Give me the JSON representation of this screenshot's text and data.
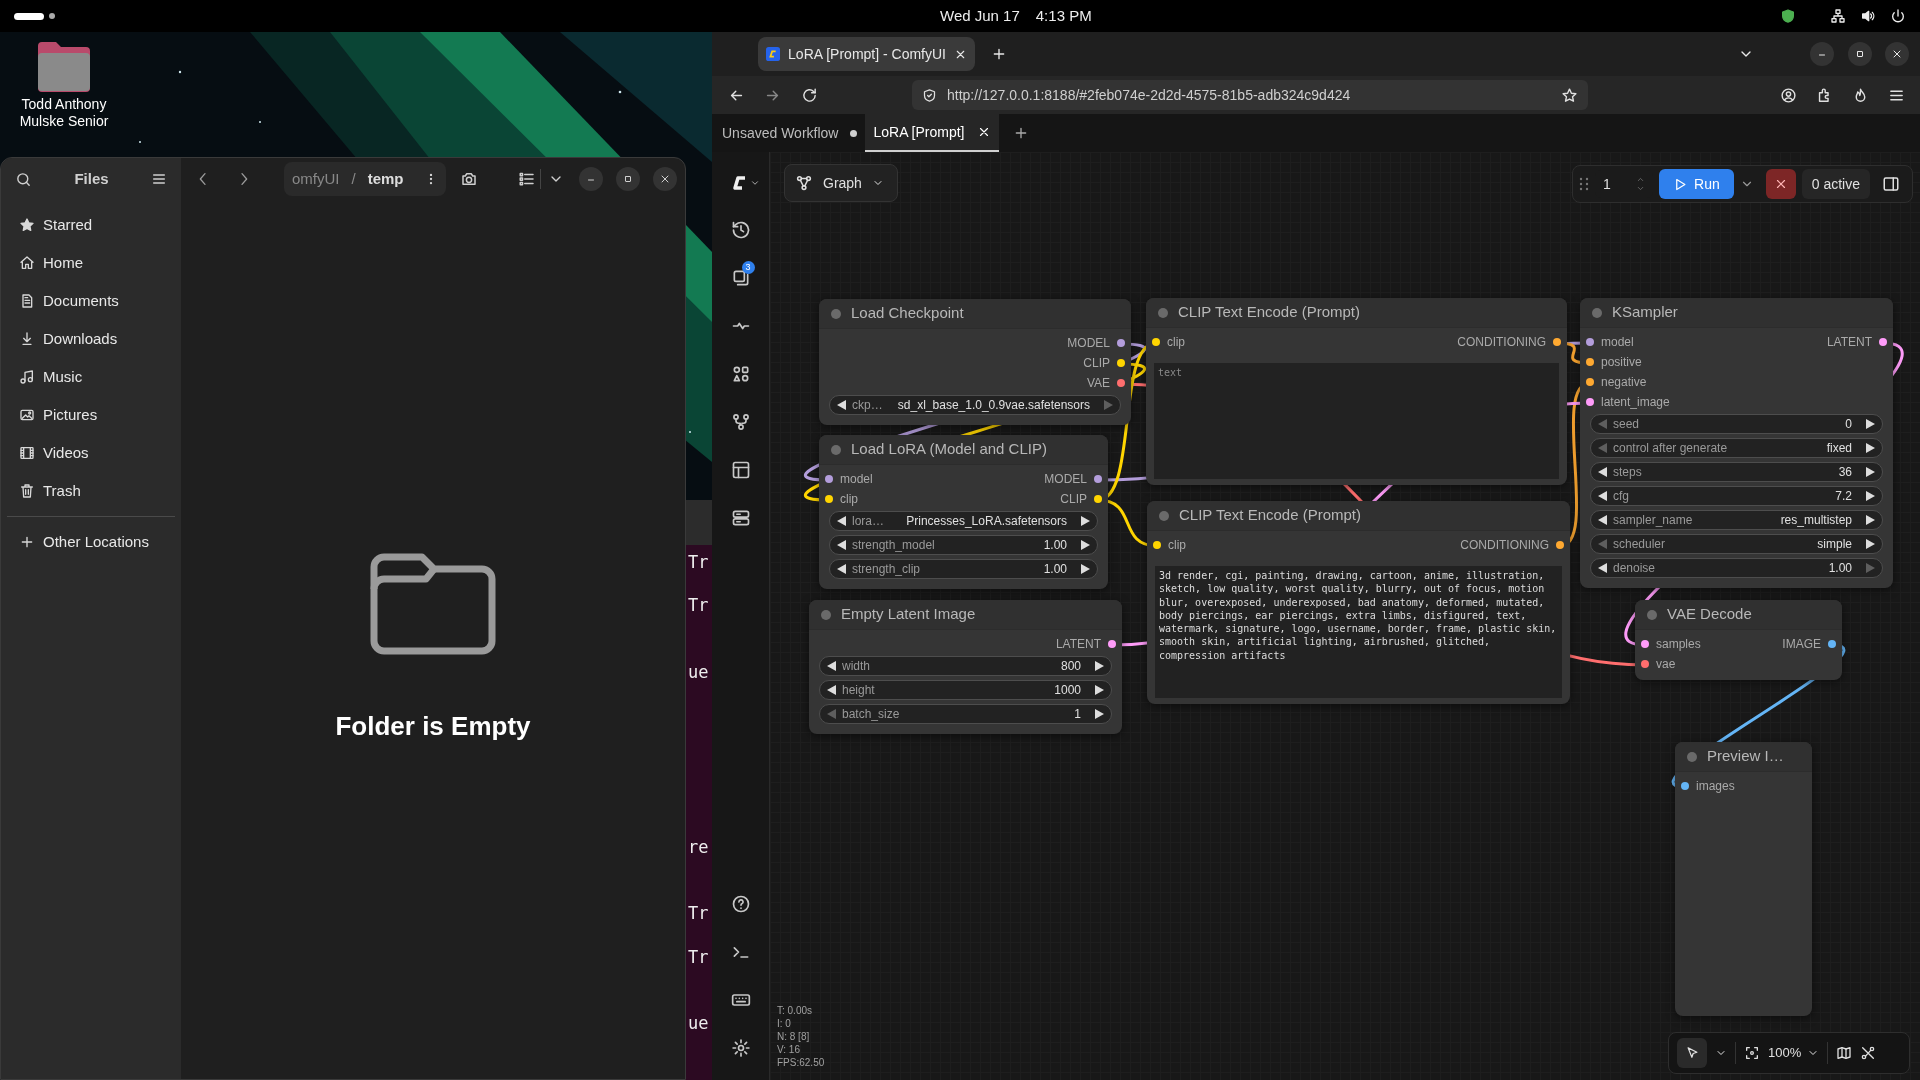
{
  "top_bar": {
    "date": "Wed Jun 17",
    "time": "4:13 PM"
  },
  "desktop": {
    "icons": [
      {
        "label": "Todd Anthony Mulske Senior"
      }
    ]
  },
  "files_window": {
    "title": "Files",
    "path": [
      "omfyUI",
      "temp"
    ],
    "path_separator": "/",
    "places": [
      {
        "label": "Starred"
      },
      {
        "label": "Home"
      },
      {
        "label": "Documents"
      },
      {
        "label": "Downloads"
      },
      {
        "label": "Music"
      },
      {
        "label": "Pictures"
      },
      {
        "label": "Videos"
      },
      {
        "label": "Trash"
      }
    ],
    "other_locations": "Other Locations",
    "empty_message": "Folder is Empty"
  },
  "terminal": {
    "fragments": [
      "Tr",
      "Tr",
      "ue",
      "re",
      "Tr",
      "Tr",
      "ue"
    ]
  },
  "browser": {
    "tabs": [
      {
        "title": "LoRA [Prompt] - ComfyUI",
        "selected": true
      }
    ],
    "url": "http://127.0.0.1:8188/#2feb074e-2d2d-4575-81b5-adb324c9d424"
  },
  "comfyui": {
    "workflow_tabs": [
      {
        "label": "Unsaved Workflow",
        "selected": false,
        "unsaved": true
      },
      {
        "label": "LoRA [Prompt]",
        "selected": true,
        "unsaved": false
      }
    ],
    "view_mode": "Graph",
    "queue_badge": "3",
    "batch_count": "1",
    "run_label": "Run",
    "active_label": "0 active",
    "nodes": [
      {
        "title": "Load Checkpoint",
        "outputs": [
          {
            "name": "MODEL",
            "color": "#b39ddb"
          },
          {
            "name": "CLIP",
            "color": "#ffd500"
          },
          {
            "name": "VAE",
            "color": "#ff6e6e"
          }
        ],
        "widgets": [
          {
            "label": "ckp…",
            "value": "sd_xl_base_1.0_0.9vae.safetensors",
            "prev_enabled": true,
            "next_enabled": false
          }
        ]
      },
      {
        "title": "Load LoRA (Model and CLIP)",
        "inputs": [
          {
            "name": "model",
            "color": "#b39ddb"
          },
          {
            "name": "clip",
            "color": "#ffd500"
          }
        ],
        "outputs": [
          {
            "name": "MODEL",
            "color": "#b39ddb"
          },
          {
            "name": "CLIP",
            "color": "#ffd500"
          }
        ],
        "widgets": [
          {
            "label": "lora…",
            "value": "Princesses_LoRA.safetensors",
            "prev_enabled": true,
            "next_enabled": true
          },
          {
            "label": "strength_model",
            "value": "1.00",
            "prev_enabled": true,
            "next_enabled": true
          },
          {
            "label": "strength_clip",
            "value": "1.00",
            "prev_enabled": true,
            "next_enabled": true
          }
        ]
      },
      {
        "title": "Empty Latent Image",
        "outputs": [
          {
            "name": "LATENT",
            "color": "#ff9cf9"
          }
        ],
        "widgets": [
          {
            "label": "width",
            "value": "800",
            "prev_enabled": true,
            "next_enabled": true
          },
          {
            "label": "height",
            "value": "1000",
            "prev_enabled": true,
            "next_enabled": true
          },
          {
            "label": "batch_size",
            "value": "1",
            "prev_enabled": false,
            "next_enabled": true
          }
        ]
      },
      {
        "title": "CLIP Text Encode (Prompt)",
        "inputs": [
          {
            "name": "clip",
            "color": "#ffd500"
          }
        ],
        "outputs": [
          {
            "name": "CONDITIONING",
            "color": "#ffa931"
          }
        ],
        "text_area": {
          "placeholder": "text"
        }
      },
      {
        "title": "CLIP Text Encode (Prompt)",
        "inputs": [
          {
            "name": "clip",
            "color": "#ffd500"
          }
        ],
        "outputs": [
          {
            "name": "CONDITIONING",
            "color": "#ffa931"
          }
        ],
        "text_area": {
          "value": "3d render, cgi, painting, drawing, cartoon, anime, illustration, sketch, low quality, worst quality, blurry, out of focus, motion blur, overexposed, underexposed, bad anatomy, deformed, mutated, body piercings, ear piercings, extra limbs, disfigured, text, watermark, signature, logo, username, border, frame, plastic skin, smooth skin, artificial lighting, airbrushed, glitched, compression artifacts"
        }
      },
      {
        "title": "KSampler",
        "inputs": [
          {
            "name": "model",
            "color": "#b39ddb"
          },
          {
            "name": "positive",
            "color": "#ffa931"
          },
          {
            "name": "negative",
            "color": "#ffa931"
          },
          {
            "name": "latent_image",
            "color": "#ff9cf9"
          }
        ],
        "outputs": [
          {
            "name": "LATENT",
            "color": "#ff9cf9"
          }
        ],
        "widgets": [
          {
            "label": "seed",
            "value": "0",
            "prev_enabled": false,
            "next_enabled": true
          },
          {
            "label": "control after generate",
            "value": "fixed",
            "prev_enabled": false,
            "next_enabled": true
          },
          {
            "label": "steps",
            "value": "36",
            "prev_enabled": true,
            "next_enabled": true
          },
          {
            "label": "cfg",
            "value": "7.2",
            "prev_enabled": true,
            "next_enabled": true
          },
          {
            "label": "sampler_name",
            "value": "res_multistep",
            "prev_enabled": true,
            "next_enabled": true
          },
          {
            "label": "scheduler",
            "value": "simple",
            "prev_enabled": false,
            "next_enabled": true
          },
          {
            "label": "denoise",
            "value": "1.00",
            "prev_enabled": true,
            "next_enabled": false
          }
        ]
      },
      {
        "title": "VAE Decode",
        "inputs": [
          {
            "name": "samples",
            "color": "#ff9cf9"
          },
          {
            "name": "vae",
            "color": "#ff6e6e"
          }
        ],
        "outputs": [
          {
            "name": "IMAGE",
            "color": "#64b5f6"
          }
        ]
      },
      {
        "title": "Preview I…",
        "inputs": [
          {
            "name": "images",
            "color": "#64b5f6"
          }
        ]
      }
    ],
    "stats": [
      "T: 0.00s",
      "I: 0",
      "N: 8 [8]",
      "V: 16",
      "FPS:62.50"
    ],
    "zoom": "100%"
  }
}
